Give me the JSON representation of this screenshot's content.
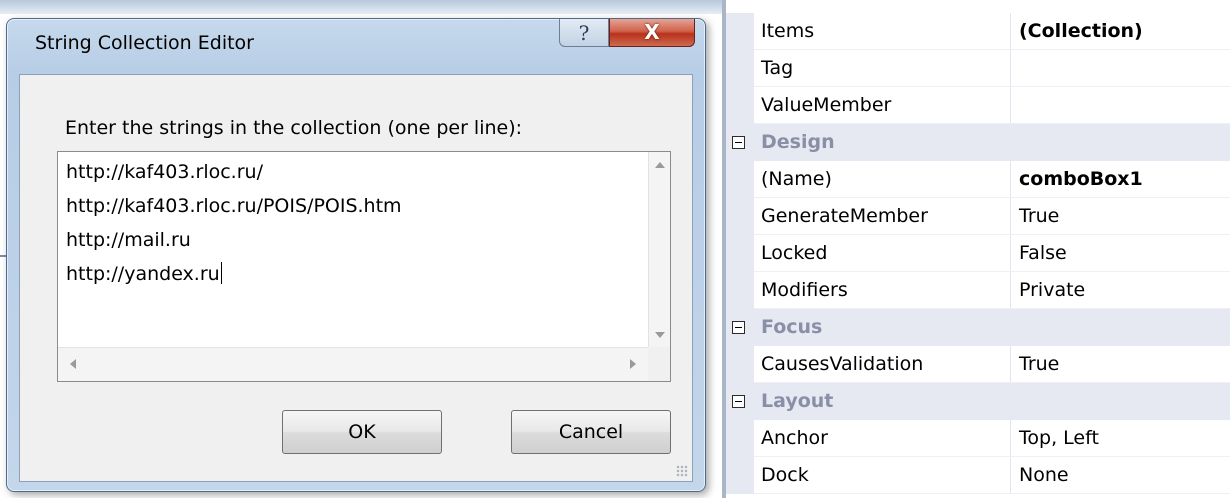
{
  "dialog": {
    "title": "String Collection Editor",
    "help_glyph": "?",
    "close_glyph": "X",
    "prompt": "Enter the strings in the collection (one per line):",
    "lines": [
      "http://kaf403.rloc.ru/",
      "http://kaf403.rloc.ru/POIS/POIS.htm",
      "http://mail.ru",
      "http://yandex.ru"
    ],
    "ok_label": "OK",
    "cancel_label": "Cancel"
  },
  "property_grid": {
    "rows": [
      {
        "type": "property",
        "name": "Items",
        "value": "(Collection)",
        "value_bold": true
      },
      {
        "type": "property",
        "name": "Tag",
        "value": ""
      },
      {
        "type": "property",
        "name": "ValueMember",
        "value": ""
      },
      {
        "type": "category",
        "name": "Design"
      },
      {
        "type": "property",
        "name": "(Name)",
        "value": "comboBox1",
        "value_bold": true
      },
      {
        "type": "property",
        "name": "GenerateMember",
        "value": "True"
      },
      {
        "type": "property",
        "name": "Locked",
        "value": "False"
      },
      {
        "type": "property",
        "name": "Modifiers",
        "value": "Private"
      },
      {
        "type": "category",
        "name": "Focus"
      },
      {
        "type": "property",
        "name": "CausesValidation",
        "value": "True"
      },
      {
        "type": "category",
        "name": "Layout"
      },
      {
        "type": "property",
        "name": "Anchor",
        "value": "Top, Left"
      },
      {
        "type": "property",
        "name": "Dock",
        "value": "None"
      }
    ]
  },
  "colors": {
    "category_background": "#e6e8f2",
    "category_text": "#8a8fa6",
    "close_button": "#c4442b"
  }
}
